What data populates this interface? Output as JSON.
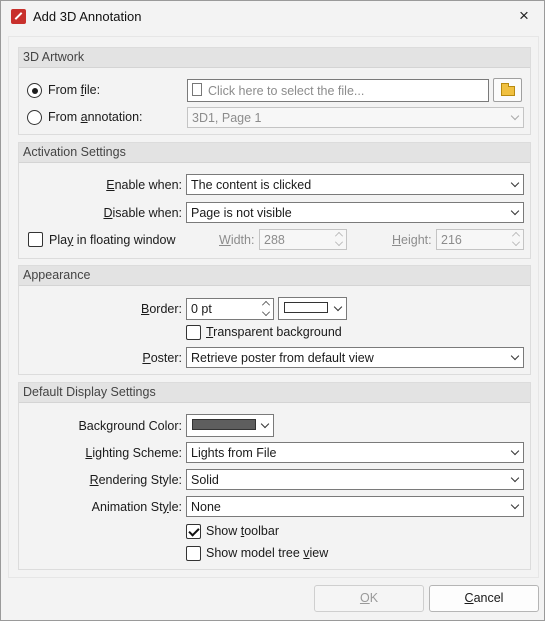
{
  "window": {
    "title": "Add 3D Annotation",
    "close": "×"
  },
  "artwork": {
    "heading": "3D Artwork",
    "from_file": {
      "pre": "From ",
      "u": "f",
      "post": "ile:"
    },
    "from_annotation": {
      "pre": "From ",
      "u": "a",
      "post": "nnotation:"
    },
    "file_placeholder": "Click here to select the file...",
    "annotation_value": "3D1, Page 1"
  },
  "activation": {
    "heading": "Activation Settings",
    "enable": {
      "pre": "",
      "u": "E",
      "post": "nable when:"
    },
    "enable_value": "The content is clicked",
    "disable": {
      "pre": "",
      "u": "D",
      "post": "isable when:"
    },
    "disable_value": "Page is not visible",
    "floating": {
      "pre": "Pla",
      "u": "y",
      "post": " in floating window"
    },
    "width": {
      "pre": "",
      "u": "W",
      "post": "idth:"
    },
    "width_value": "288",
    "height": {
      "pre": "",
      "u": "H",
      "post": "eight:"
    },
    "height_value": "216"
  },
  "appearance": {
    "heading": "Appearance",
    "border": {
      "pre": "",
      "u": "B",
      "post": "order:"
    },
    "border_value": "0 pt",
    "border_color": "#ffffff",
    "transparent": {
      "pre": "",
      "u": "T",
      "post": "ransparent background"
    },
    "poster": {
      "pre": "",
      "u": "P",
      "post": "oster:"
    },
    "poster_value": "Retrieve poster from default view"
  },
  "display": {
    "heading": "Default Display Settings",
    "bg_color": "Background Color:",
    "bg_color_value": "#5e5e5e",
    "lighting": {
      "pre": "",
      "u": "L",
      "post": "ighting Scheme:"
    },
    "lighting_value": "Lights from File",
    "rendering": {
      "pre": "",
      "u": "R",
      "post": "endering Style:"
    },
    "rendering_value": "Solid",
    "animation": {
      "pre": "Animation St",
      "u": "y",
      "post": "le:"
    },
    "animation_value": "None",
    "show_toolbar": {
      "pre": "Show ",
      "u": "t",
      "post": "oolbar"
    },
    "show_tree": {
      "pre": "Show model tree ",
      "u": "v",
      "post": "iew"
    }
  },
  "buttons": {
    "ok": {
      "pre": "",
      "u": "O",
      "post": "K"
    },
    "cancel": {
      "pre": "",
      "u": "C",
      "post": "ancel"
    }
  }
}
